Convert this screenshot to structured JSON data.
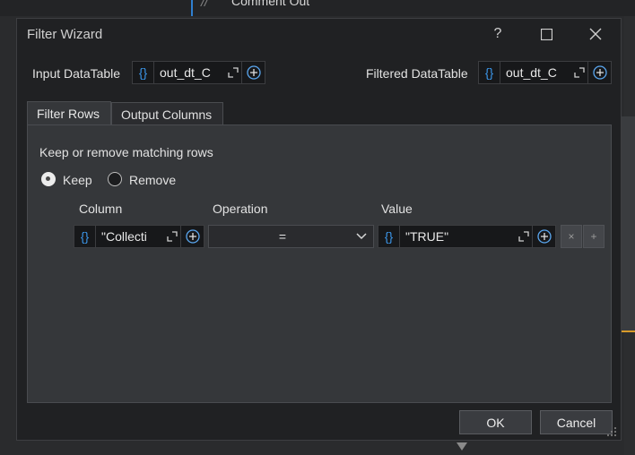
{
  "background": {
    "text": "Comment Out"
  },
  "dialog": {
    "title": "Filter Wizard",
    "controls": {
      "help": "?",
      "maximize": "☐",
      "close": "✕"
    },
    "input_datatable": {
      "label": "Input DataTable",
      "value": "out_dt_C",
      "braces": "{}"
    },
    "filtered_datatable": {
      "label": "Filtered DataTable",
      "value": "out_dt_C",
      "braces": "{}"
    },
    "tabs": [
      {
        "label": "Filter Rows",
        "active": true
      },
      {
        "label": "Output Columns",
        "active": false
      }
    ],
    "filter_rows": {
      "heading": "Keep or remove matching rows",
      "options": [
        {
          "label": "Keep",
          "selected": true
        },
        {
          "label": "Remove",
          "selected": false
        }
      ],
      "headers": {
        "column": "Column",
        "operation": "Operation",
        "value": "Value"
      },
      "rows": [
        {
          "column": "\"Collecti",
          "operation": "=",
          "value": "\"TRUE\""
        }
      ],
      "row_buttons": {
        "remove": "×",
        "add": "+"
      }
    },
    "buttons": {
      "ok": "OK",
      "cancel": "Cancel"
    }
  },
  "colors": {
    "accent": "#3b95e8",
    "dialog_bg": "#202123",
    "panel_bg": "#35373a"
  }
}
